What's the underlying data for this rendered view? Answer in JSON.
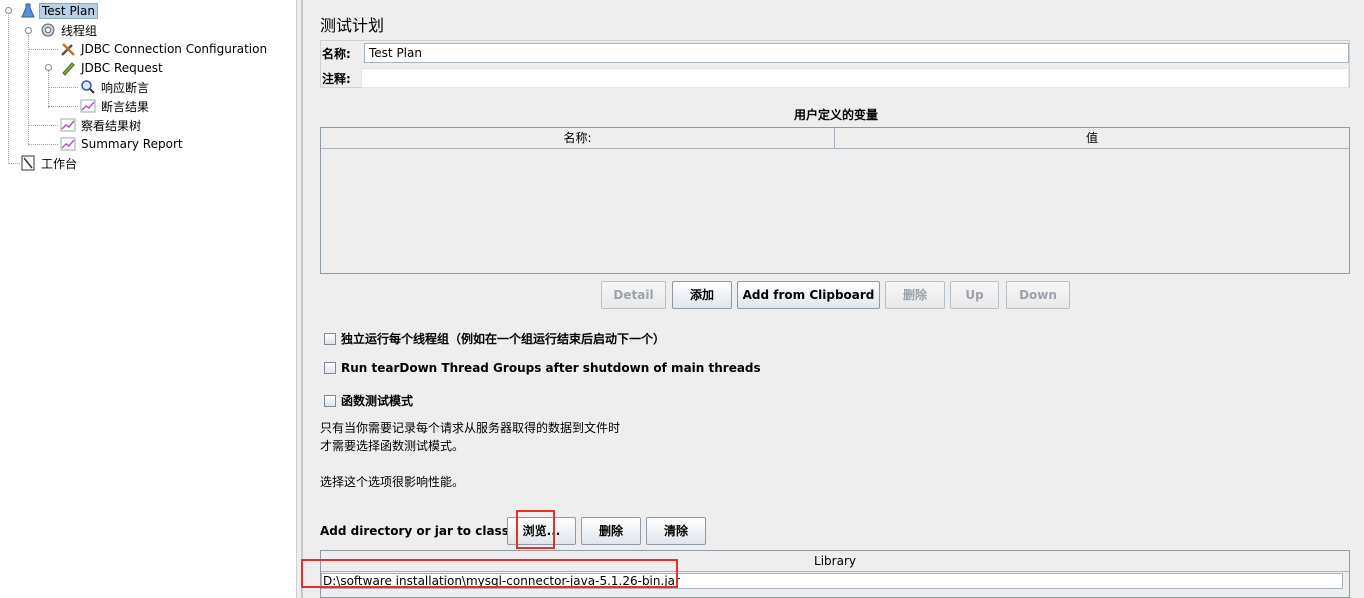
{
  "tree": {
    "items": [
      {
        "label": "Test Plan",
        "icon": "flask-icon"
      },
      {
        "label": "线程组",
        "icon": "gear-icon"
      },
      {
        "label": "JDBC Connection Configuration",
        "icon": "tools-icon"
      },
      {
        "label": "JDBC Request",
        "icon": "pen-icon"
      },
      {
        "label": "响应断言",
        "icon": "magnifier-icon"
      },
      {
        "label": "断言结果",
        "icon": "graph-icon"
      },
      {
        "label": "察看结果树",
        "icon": "graph-icon"
      },
      {
        "label": "Summary Report",
        "icon": "graph-icon"
      },
      {
        "label": "工作台",
        "icon": "workbench-icon"
      }
    ]
  },
  "panel": {
    "title": "测试计划",
    "name_label": "名称:",
    "name_value": "Test Plan",
    "comment_label": "注释:",
    "comment_value": ""
  },
  "variables": {
    "title": "用户定义的变量",
    "columns": [
      "名称:",
      "值"
    ],
    "rows": []
  },
  "buttons": {
    "detail": "Detail",
    "add": "添加",
    "add_clipboard": "Add from Clipboard",
    "delete": "删除",
    "up": "Up",
    "down": "Down"
  },
  "options": {
    "serialize": "独立运行每个线程组（例如在一个组运行结束后启动下一个）",
    "teardown": "Run tearDown Thread Groups after shutdown of main threads",
    "functional": "函数测试模式",
    "note_line1": "只有当你需要记录每个请求从服务器取得的数据到文件时",
    "note_line2": "才需要选择函数测试模式。",
    "note_line3": "选择这个选项很影响性能。"
  },
  "classpath": {
    "label": "Add directory or jar to classpath",
    "browse": "浏览...",
    "delete": "删除",
    "clear": "清除",
    "column": "Library",
    "entries": [
      "D:\\software installation\\mysql-connector-java-5.1.26-bin.jar"
    ]
  },
  "colors": {
    "selection": "#b8cfe5",
    "highlight": "#e03030",
    "panel_bg": "#eeeeee"
  }
}
